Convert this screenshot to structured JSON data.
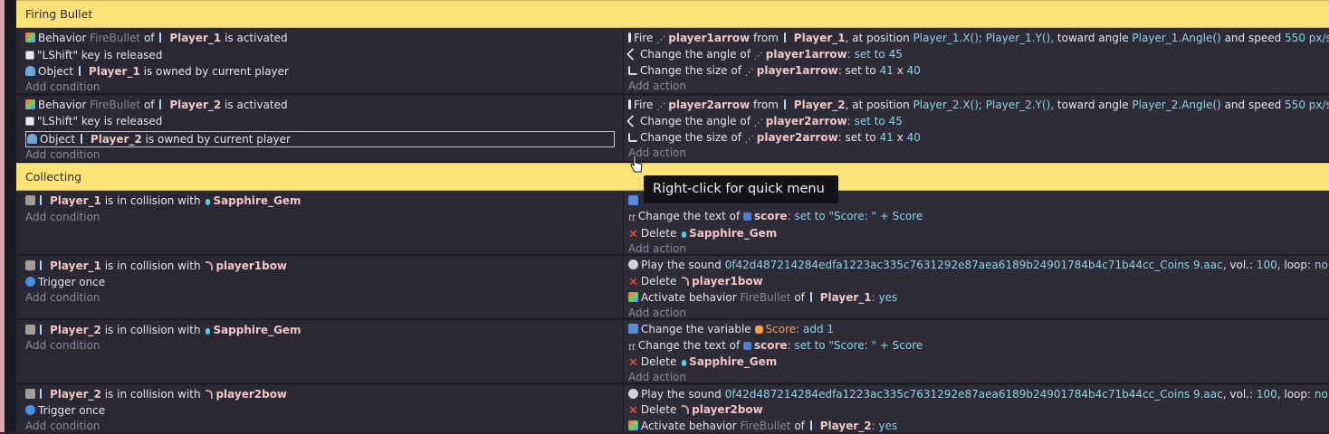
{
  "groups": {
    "firing_bullet": "Firing Bullet",
    "collecting": "Collecting"
  },
  "add_condition": "Add condition",
  "add_action": "Add action",
  "tooltip": "Right-click for quick menu",
  "ev1": {
    "c1": {
      "pre": "Behavior",
      "beh": "FireBullet",
      "of": "of",
      "obj": "Player_1",
      "post": "is activated"
    },
    "c2": {
      "key": "\"LShift\"",
      "post": "key is released"
    },
    "c3": {
      "pre": "Object",
      "obj": "Player_1",
      "post": "is owned by current player"
    },
    "a1": {
      "pre": "Fire",
      "obj": "player1arrow",
      "from": "from",
      "src": "Player_1",
      "at": ", at position",
      "x": "Player_1.X();",
      "y": "Player_1.Y(),",
      "toward": "toward angle",
      "ang": "Player_1.Angle()",
      "speed": "and speed",
      "sv": "550",
      "unit": "px/s"
    },
    "a2": {
      "pre": "Change the angle of",
      "obj": "player1arrow",
      "setto": ": set to",
      "val": "45"
    },
    "a3": {
      "pre": "Change the size of",
      "obj": "player1arrow",
      "setto": ": set to",
      "w": "41",
      "x": "x",
      "h": "40"
    }
  },
  "ev2": {
    "c1": {
      "pre": "Behavior",
      "beh": "FireBullet",
      "of": "of",
      "obj": "Player_2",
      "post": "is activated"
    },
    "c2": {
      "key": "\"LShift\"",
      "post": "key is released"
    },
    "c3": {
      "pre": "Object",
      "obj": "Player_2",
      "post": "is owned by current player"
    },
    "a1": {
      "pre": "Fire",
      "obj": "player2arrow",
      "from": "from",
      "src": "Player_2",
      "at": ", at position",
      "x": "Player_2.X();",
      "y": "Player_2.Y(),",
      "toward": "toward angle",
      "ang": "Player_2.Angle()",
      "speed": "and speed",
      "sv": "550",
      "unit": "px/s"
    },
    "a2": {
      "pre": "Change the angle of",
      "obj": "player2arrow",
      "setto": ": set to",
      "val": "45"
    },
    "a3": {
      "pre": "Change the size of",
      "obj": "player2arrow",
      "setto": ": set to",
      "w": "41",
      "x": "x",
      "h": "40"
    }
  },
  "ev3": {
    "c1": {
      "obj": "Player_1",
      "mid": "is in collision with",
      "obj2": "Sapphire_Gem"
    },
    "a2": {
      "pre": "Change the text of",
      "obj": "score",
      "setto": ": set to",
      "val": "\"Score: \" + Score"
    },
    "a3": {
      "pre": "Delete",
      "obj": "Sapphire_Gem"
    }
  },
  "ev4": {
    "c1": {
      "obj": "Player_1",
      "mid": "is in collision with",
      "obj2": "player1bow"
    },
    "c2": {
      "text": "Trigger once"
    },
    "a1": {
      "pre": "Play the sound",
      "file": "0f42d487214284edfa1223ac335c7631292e87aea6189b24901784b4c71b44cc_Coins 9.aac",
      "vol": ", vol.:",
      "volv": "100",
      "loop": ", loop:",
      "loopv": "no"
    },
    "a2": {
      "pre": "Delete",
      "obj": "player1bow"
    },
    "a3": {
      "pre": "Activate behavior",
      "beh": "FireBullet",
      "of": "of",
      "obj": "Player_1",
      "colon": ":",
      "val": "yes"
    }
  },
  "ev5": {
    "c1": {
      "obj": "Player_2",
      "mid": "is in collision with",
      "obj2": "Sapphire_Gem"
    },
    "a1": {
      "pre": "Change the variable",
      "var": "Score",
      "colon": ":",
      "op": "add",
      "val": "1"
    },
    "a2": {
      "pre": "Change the text of",
      "obj": "score",
      "setto": ": set to",
      "val": "\"Score: \" + Score"
    },
    "a3": {
      "pre": "Delete",
      "obj": "Sapphire_Gem"
    }
  },
  "ev6": {
    "c1": {
      "obj": "Player_2",
      "mid": "is in collision with",
      "obj2": "player2bow"
    },
    "c2": {
      "text": "Trigger once"
    },
    "a1": {
      "pre": "Play the sound",
      "file": "0f42d487214284edfa1223ac335c7631292e87aea6189b24901784b4c71b44cc_Coins 9.aac",
      "vol": ", vol.:",
      "volv": "100",
      "loop": ", loop:",
      "loopv": "no"
    },
    "a2": {
      "pre": "Delete",
      "obj": "player2bow"
    },
    "a3": {
      "pre": "Activate behavior",
      "beh": "FireBullet",
      "of": "of",
      "obj": "Player_2",
      "colon": ":",
      "val": "yes"
    }
  }
}
